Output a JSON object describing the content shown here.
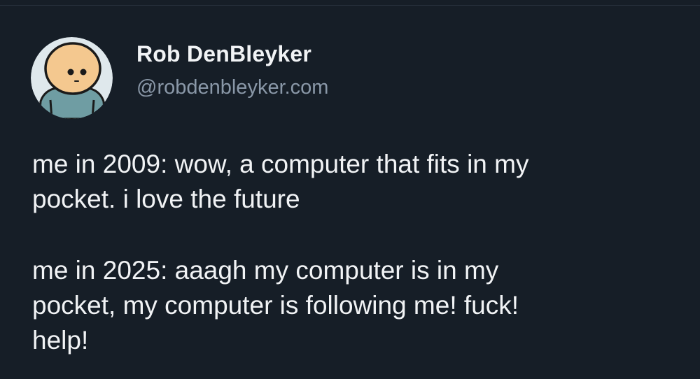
{
  "theme": {
    "background": "#161e27",
    "text_primary": "#f1f3f5",
    "text_secondary": "#8a98a8",
    "avatar_background": "#dfe8ec",
    "avatar_skin": "#f4c88f",
    "avatar_shirt": "#6f9da3"
  },
  "post": {
    "author": {
      "display_name": "Rob DenBleyker",
      "handle": "@robdenbleyker.com",
      "avatar_icon": "cartoon-character-avatar"
    },
    "paragraphs": [
      {
        "lines": [
          "me in 2009: wow, a computer that fits in my",
          "pocket. i love the future"
        ]
      },
      {
        "lines": [
          "me in 2025: aaagh my computer is in my",
          "pocket, my computer is following me! fuck!",
          "help!"
        ]
      }
    ]
  }
}
